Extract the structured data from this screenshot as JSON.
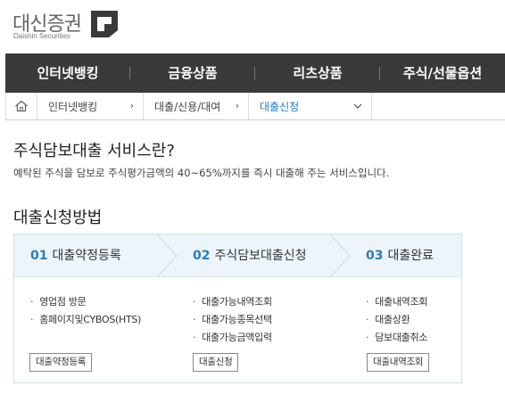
{
  "logo": {
    "name": "대신증권",
    "sub": "Daishin Securities"
  },
  "gnb": [
    "인터넷뱅킹",
    "금융상품",
    "리츠상품",
    "주식/선물옵션"
  ],
  "breadcrumb": {
    "level1": "인터넷뱅킹",
    "level2": "대출/신용/대여",
    "level3": "대출신청"
  },
  "intro": {
    "title": "주식담보대출 서비스란?",
    "description": "예탁된 주식을 담보로 주식평가금액의 40~65%까지를 즉시 대출해 주는 서비스입니다."
  },
  "process": {
    "title": "대출신청방법",
    "steps": [
      {
        "num": "01",
        "title": "대출약정등록",
        "items": [
          "영업점 방문",
          "홈페이지및CYBOS(HTS)"
        ],
        "button": "대출약정등록"
      },
      {
        "num": "02",
        "title": "주식담보대출신청",
        "items": [
          "대출가능내역조회",
          "대출가능종목선택",
          "대출가능금액입력"
        ],
        "button": "대출신청"
      },
      {
        "num": "03",
        "title": "대출완료",
        "items": [
          "대출내역조회",
          "대출상환",
          "담보대출취소"
        ],
        "button": "대출내역조회"
      }
    ]
  },
  "colors": {
    "accent": "#2b7bc0",
    "gnb_bg": "#3a3a3a",
    "step_head_bg": "#edf5fb"
  }
}
